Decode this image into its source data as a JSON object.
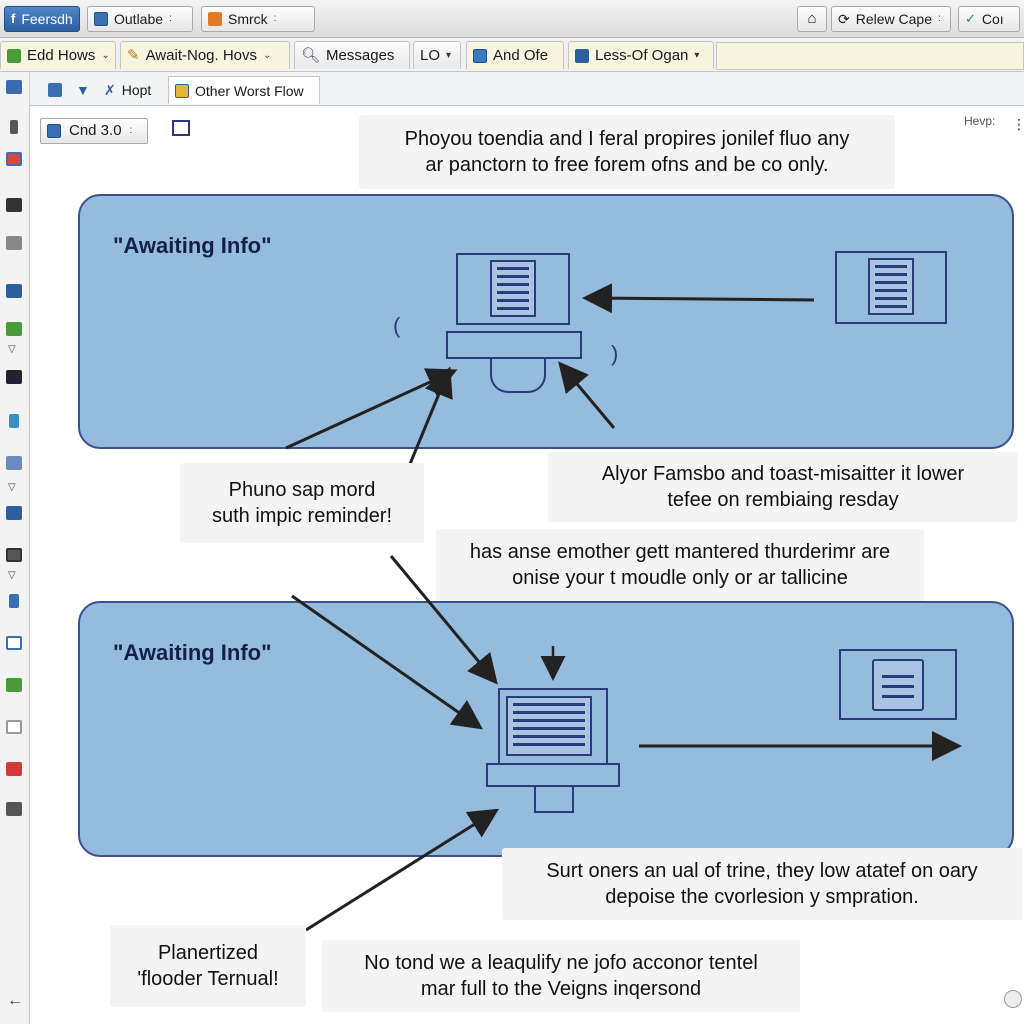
{
  "topbar": {
    "items": [
      {
        "label": "Feersdh",
        "icon": "facebook-f-icon"
      },
      {
        "label": "Outlabe",
        "icon": "window-icon"
      },
      {
        "label": "Smrck",
        "icon": "orange-square-icon"
      },
      {
        "label": "Relew Cape",
        "icon": "refresh-icon"
      },
      {
        "label": "Coı",
        "icon": "check-icon"
      }
    ],
    "home_icon": "home-icon"
  },
  "secondbar": {
    "tabs": [
      {
        "label": "Edd Hows",
        "icon": "green-folder-icon"
      },
      {
        "label": "Await-Nog. Hovs",
        "icon": "pencil-icon"
      },
      {
        "label": "Messages",
        "icon": "magnifier-icon"
      },
      {
        "label": "LO"
      },
      {
        "label": "And Ofe",
        "icon": "calendar-icon"
      },
      {
        "label": "Less-Of Ogan",
        "icon": "camera-icon"
      }
    ]
  },
  "thirdbar": {
    "items": [
      {
        "label": "Hopt",
        "icon": "cursor-icon"
      },
      {
        "label": "Other Worst Flow",
        "icon": "folder-icon"
      }
    ]
  },
  "version": {
    "label": "Cnd 3.0"
  },
  "help": {
    "label": "Hevp:"
  },
  "notes": {
    "top": [
      "Phoyou toendia and I feral propires jonilef fluo any",
      "ar panctorn to free forem ofns and be co only."
    ],
    "mid_left": [
      "Phuno sap mord",
      "suth impic reminder!"
    ],
    "mid_right": [
      "Alyor Famsbo and toast-misaitter it lower",
      "tefee on rembiaing resday"
    ],
    "center": [
      "has anse emother gett mantered thurderimr are",
      "onise your t moudle only or ar tallicine"
    ],
    "bottom_right": [
      "Surt oners an ual of trine, they low atatef on oary",
      "depoise the cvorlesion y smpration."
    ],
    "bottom_left": [
      "Planertized",
      "'flooder Ternual!"
    ],
    "bottom_center": [
      "No tond we a leaqulify ne jofo acconor tentel",
      "mar full to the Veigns inqersond"
    ]
  },
  "lanes": [
    {
      "title": "\"Awaiting Info\""
    },
    {
      "title": "\"Awaiting Info\""
    }
  ],
  "colors": {
    "lane_fill": "#95bbdd",
    "lane_border": "#3b4f90",
    "arrow": "#2a2a2a"
  }
}
